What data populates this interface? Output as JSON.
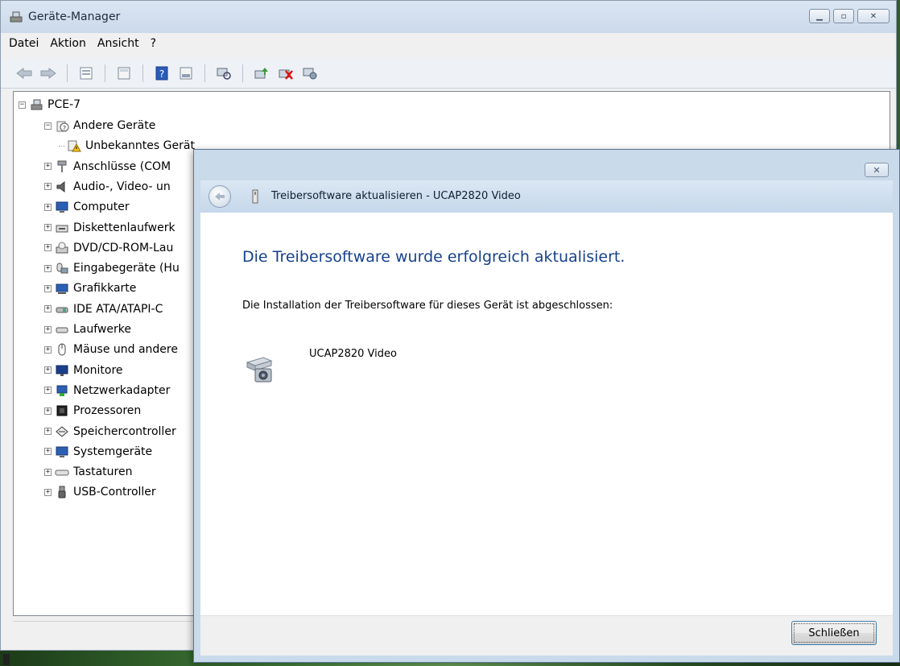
{
  "window": {
    "title": "Geräte-Manager",
    "icon": "device-manager-icon"
  },
  "menu": [
    "Datei",
    "Aktion",
    "Ansicht",
    "?"
  ],
  "toolbar_icons": [
    "back-arrow-icon",
    "forward-arrow-icon",
    "properties-sheet-icon",
    "list-view-icon",
    "help-icon",
    "details-icon",
    "scan-hardware-icon",
    "update-driver-icon",
    "uninstall-icon",
    "disable-device-icon"
  ],
  "tree": {
    "root": "PCE-7",
    "items": [
      {
        "label": "Andere Geräte",
        "icon": "unknown-device-icon",
        "expanded": true,
        "children": [
          "Unbekanntes Gerät"
        ]
      },
      {
        "label": "Anschlüsse (COM",
        "icon": "port-icon"
      },
      {
        "label": "Audio-, Video- un",
        "icon": "speaker-icon"
      },
      {
        "label": "Computer",
        "icon": "computer-icon"
      },
      {
        "label": "Diskettenlaufwerk",
        "icon": "floppy-drive-icon"
      },
      {
        "label": "DVD/CD-ROM-Lau",
        "icon": "dvd-drive-icon"
      },
      {
        "label": "Eingabegeräte (Hu",
        "icon": "input-device-icon"
      },
      {
        "label": "Grafikkarte",
        "icon": "display-adapter-icon"
      },
      {
        "label": "IDE ATA/ATAPI-C",
        "icon": "ide-controller-icon"
      },
      {
        "label": "Laufwerke",
        "icon": "disk-drive-icon"
      },
      {
        "label": "Mäuse und andere",
        "icon": "mouse-icon"
      },
      {
        "label": "Monitore",
        "icon": "monitor-icon"
      },
      {
        "label": "Netzwerkadapter",
        "icon": "network-adapter-icon"
      },
      {
        "label": "Prozessoren",
        "icon": "processor-icon"
      },
      {
        "label": "Speichercontroller",
        "icon": "storage-controller-icon"
      },
      {
        "label": "Systemgeräte",
        "icon": "system-device-icon"
      },
      {
        "label": "Tastaturen",
        "icon": "keyboard-icon"
      },
      {
        "label": "USB-Controller",
        "icon": "usb-icon"
      }
    ]
  },
  "dialog": {
    "title": "Treibersoftware aktualisieren - UCAP2820 Video",
    "heading": "Die Treibersoftware wurde erfolgreich aktualisiert.",
    "description": "Die Installation der Treibersoftware für dieses Gerät ist abgeschlossen:",
    "device_name": "UCAP2820 Video",
    "device_icon": "video-capture-device-icon",
    "close_button": "Schließen",
    "heading_color": "#16418c"
  }
}
